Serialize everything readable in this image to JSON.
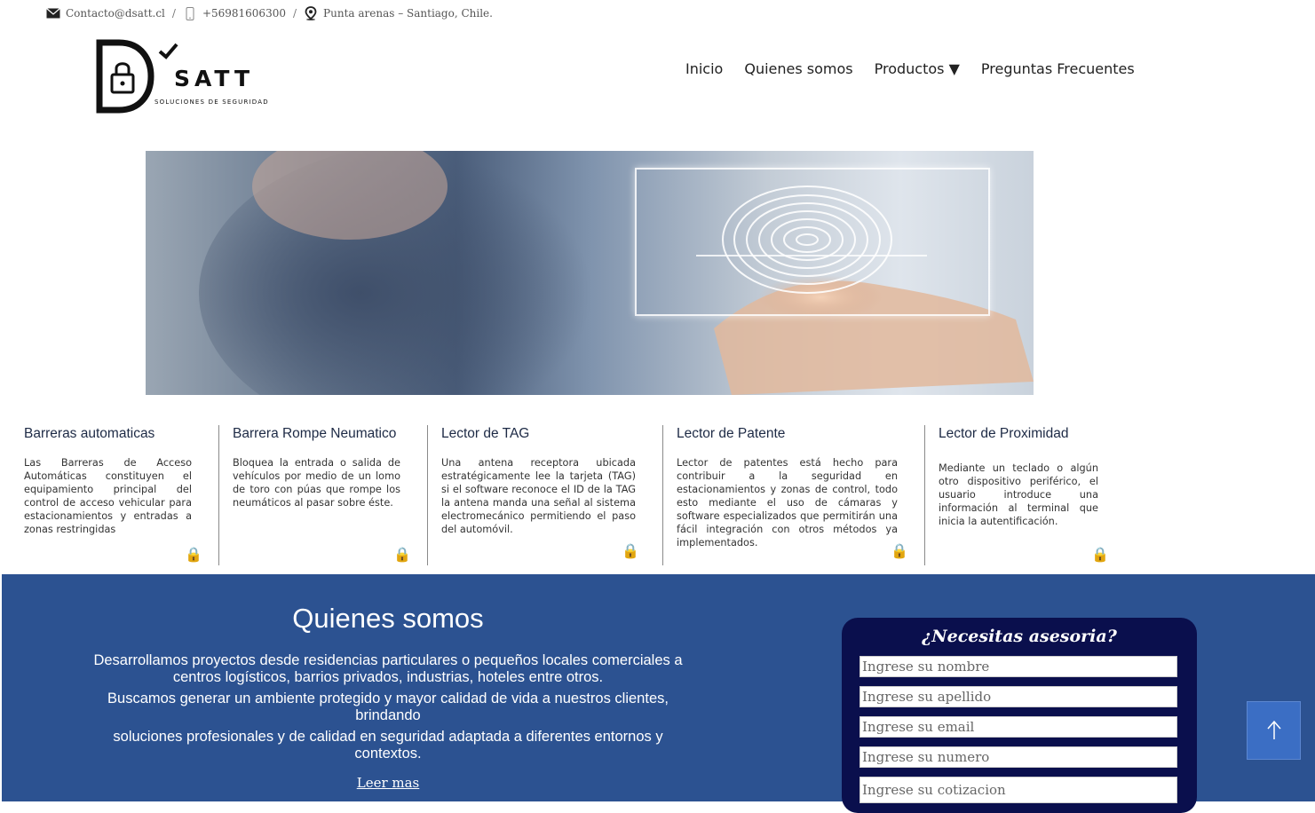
{
  "topbar": {
    "email": "Contacto@dsatt.cl",
    "phone": "+56981606300",
    "location": "Punta arenas – Santiago, Chile.",
    "separator": "/"
  },
  "logo": {
    "name": "SATT",
    "tagline": "SOLUCIONES DE SEGURIDAD"
  },
  "nav": {
    "items": [
      "Inicio",
      "Quienes somos",
      "Productos ▼",
      "Preguntas Frecuentes"
    ]
  },
  "products": [
    {
      "title": "Barreras automaticas",
      "description": "Las Barreras de Acceso Automáticas constituyen el equipamiento principal del control de acceso vehicular para estacionamientos y entradas a zonas restringidas"
    },
    {
      "title": "Barrera Rompe Neumatico",
      "description": "Bloquea la entrada o salida de vehículos por medio de un lomo de toro con púas que rompe los neumáticos al pasar sobre éste."
    },
    {
      "title": "Lector de TAG",
      "description": "Una antena receptora ubicada estratégicamente lee la tarjeta (TAG) si el software reconoce el ID de la TAG la antena manda una señal al sistema electromecánico permitiendo el paso del automóvil."
    },
    {
      "title": "Lector de Patente",
      "description": "Lector de patentes está hecho para contribuir a la seguridad en estacionamientos y zonas de control, todo esto mediante el uso de cámaras y software especializados que permitirán una fácil integración con otros métodos ya implementados."
    },
    {
      "title": "Lector de Proximidad",
      "description": "Mediante un teclado o algún otro dispositivo periférico, el usuario introduce una información al terminal que inicia la autentificación."
    }
  ],
  "about": {
    "title": "Quienes somos",
    "lines": [
      "Desarrollamos proyectos desde residencias particulares o pequeños locales comerciales a centros logísticos, barrios privados, industrias, hoteles entre otros.",
      "Buscamos generar un ambiente protegido y mayor calidad de vida a nuestros clientes, brindando",
      "soluciones profesionales y de calidad en seguridad adaptada a diferentes entornos y contextos."
    ],
    "more_link": "Leer mas"
  },
  "form": {
    "title": "¿Necesitas asesoria?",
    "placeholders": {
      "nombre": "Ingrese su nombre",
      "apellido": "Ingrese su apellido",
      "email": "Ingrese su email",
      "numero": "Ingrese su numero",
      "cotizacion": "Ingrese su cotizacion"
    }
  },
  "colors": {
    "about_bg": "#2c5291",
    "form_bg": "#0a0f4d",
    "totop_bg": "#3b6ec4",
    "lock_blue": "#3a8ad8"
  },
  "icons": [
    "mail-icon",
    "phone-icon",
    "location-pin-icon",
    "lock-icon",
    "arrow-up-icon",
    "checkmark-icon"
  ]
}
